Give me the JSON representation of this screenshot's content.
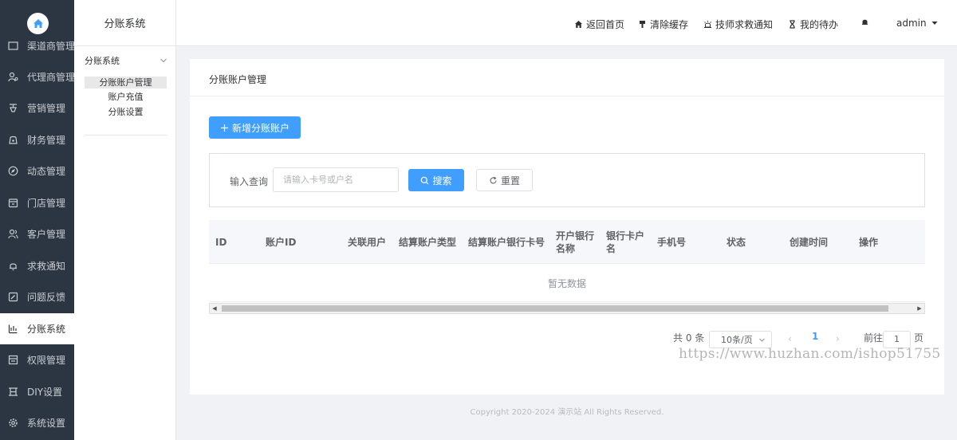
{
  "sidebar": {
    "items": [
      {
        "label": "渠道商管理",
        "icon": "channel-icon"
      },
      {
        "label": "代理商管理",
        "icon": "agent-icon"
      },
      {
        "label": "营销管理",
        "icon": "marketing-icon"
      },
      {
        "label": "财务管理",
        "icon": "finance-icon"
      },
      {
        "label": "动态管理",
        "icon": "compass-icon"
      },
      {
        "label": "门店管理",
        "icon": "store-icon"
      },
      {
        "label": "客户管理",
        "icon": "customer-icon"
      },
      {
        "label": "求救通知",
        "icon": "bell-icon"
      },
      {
        "label": "问题反馈",
        "icon": "feedback-icon"
      },
      {
        "label": "分账系统",
        "icon": "split-icon"
      },
      {
        "label": "权限管理",
        "icon": "permission-icon"
      },
      {
        "label": "DIY设置",
        "icon": "diy-icon"
      },
      {
        "label": "系统设置",
        "icon": "gear-icon"
      }
    ],
    "active_index": 9
  },
  "subsidebar": {
    "title": "分账系统",
    "group": "分账系统",
    "entries": [
      "分账账户管理",
      "账户充值",
      "分账设置"
    ],
    "active_index": 0
  },
  "header": {
    "home": "返回首页",
    "clear_cache": "清除缓存",
    "tech_alert": "技师求救通知",
    "todo": "我的待办",
    "user": "admin"
  },
  "card": {
    "title": "分账账户管理",
    "add_button": "新增分账账户",
    "query_label": "输入查询",
    "search_placeholder": "请输入卡号或户名",
    "search_button": "搜索",
    "reset_button": "重置",
    "columns": [
      "ID",
      "账户ID",
      "关联用户",
      "结算账户类型",
      "结算账户银行卡号",
      "开户银行名称",
      "银行卡户名",
      "手机号",
      "状态",
      "创建时间",
      "操作"
    ],
    "empty_text": "暂无数据"
  },
  "pagination": {
    "total": "共 0 条",
    "page_size": "10条/页",
    "current_page": "1",
    "goto_label": "前往",
    "goto_value": "1",
    "page_unit": "页"
  },
  "footer": "Copyright 2020-2024 演示站 All Rights Reserved.",
  "watermark": "https://www.huzhan.com/ishop51755",
  "colors": {
    "primary": "#409eff",
    "sidebar_bg": "#2c3642"
  }
}
